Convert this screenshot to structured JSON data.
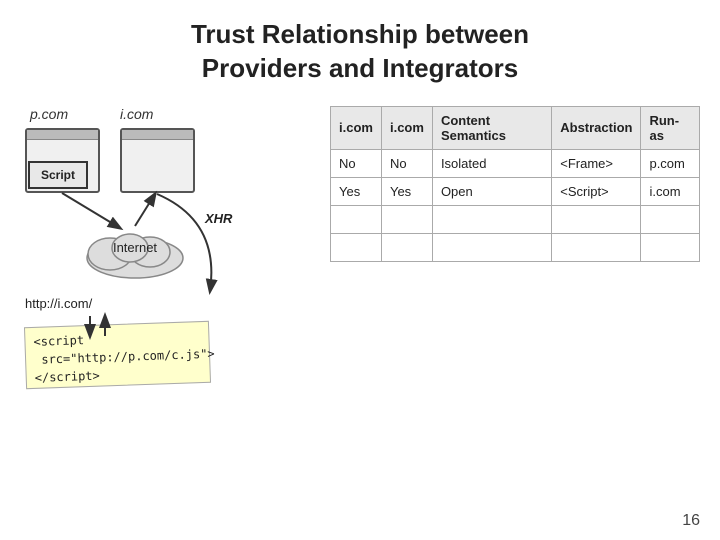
{
  "title": {
    "line1": "Trust Relationship between",
    "line2": "Providers and Integrators"
  },
  "diagram": {
    "label_pcom": "p.com",
    "label_icom": "i.com",
    "script_label": "Script",
    "internet_label": "Internet",
    "xhr_label": "XHR",
    "http_label": "http://i.com/",
    "code_text": "<script src=\"http://p.com/c.js\">\n</script>"
  },
  "table": {
    "headers": [
      "i.com",
      "i.com",
      "Content Semantics",
      "Abstraction",
      "Run-as"
    ],
    "rows": [
      [
        "No",
        "No",
        "Isolated",
        "<Frame>",
        "p.com"
      ],
      [
        "Yes",
        "Yes",
        "Open",
        "<Script>",
        "i.com"
      ]
    ]
  },
  "page_number": "16"
}
